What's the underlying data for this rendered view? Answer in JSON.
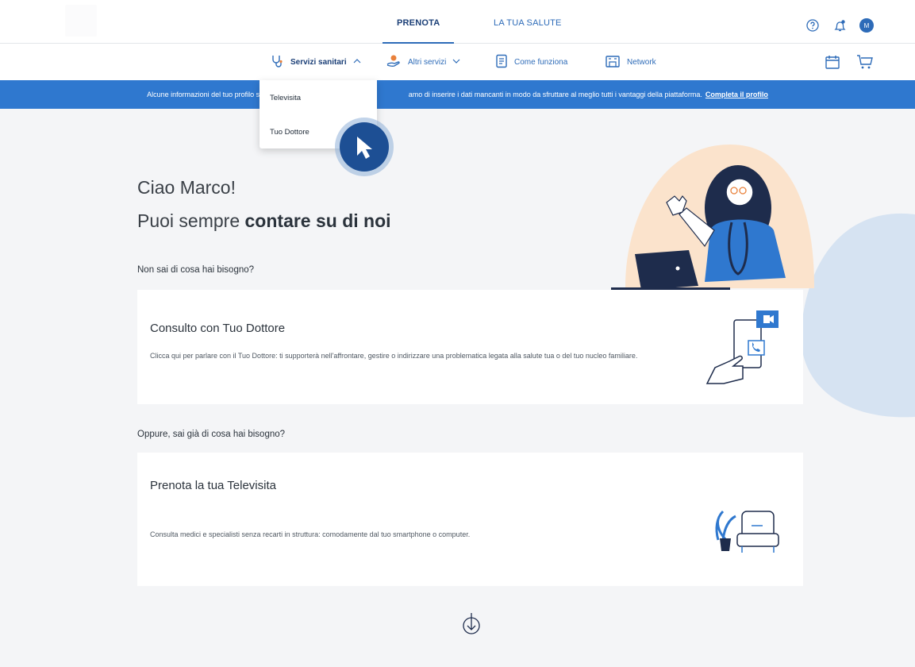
{
  "nav": {
    "tabs": [
      "PRENOTA",
      "LA TUA SALUTE"
    ],
    "icons": [
      "help-icon",
      "bell-icon",
      "avatar"
    ],
    "avatar_initial": "M"
  },
  "subnav": {
    "items": [
      {
        "label": "Servizi sanitari",
        "icon": "stethoscope-icon"
      },
      {
        "label": "Altri servizi",
        "icon": "hand-icon"
      },
      {
        "label": "Come funziona",
        "icon": "document-icon"
      },
      {
        "label": "Network",
        "icon": "building-icon"
      }
    ],
    "right_icons": [
      "calendar-icon",
      "cart-icon"
    ]
  },
  "banner": {
    "text_left": "Alcune informazioni del tuo profilo sono ar",
    "text_right": "amo di inserire i dati mancanti in modo da sfruttare al meglio tutti i vantaggi della piattaforma.",
    "link": "Completa il profilo"
  },
  "dropdown": {
    "items": [
      "Televisita",
      "Tuo Dottore"
    ]
  },
  "hero": {
    "greeting": "Ciao Marco!",
    "tagline_prefix": "Puoi sempre",
    "tagline_bold": "contare su di noi"
  },
  "section1": {
    "label": "Non sai di cosa hai bisogno?"
  },
  "card1": {
    "title": "Consulto con Tuo Dottore",
    "desc": "Clicca qui per parlare con il Tuo Dottore: ti supporterà nell'affrontare, gestire o indirizzare una problematica legata alla salute tua o del tuo nucleo familiare."
  },
  "section2": {
    "label": "Oppure, sai già di cosa hai bisogno?"
  },
  "card2": {
    "title": "Prenota la tua Televisita",
    "desc": "Consulta medici e specialisti senza recarti in struttura: comodamente dal tuo smartphone o computer."
  },
  "colors": {
    "primary": "#2d6bb8",
    "banner": "#2f78cf",
    "accent": "#e9813b"
  }
}
